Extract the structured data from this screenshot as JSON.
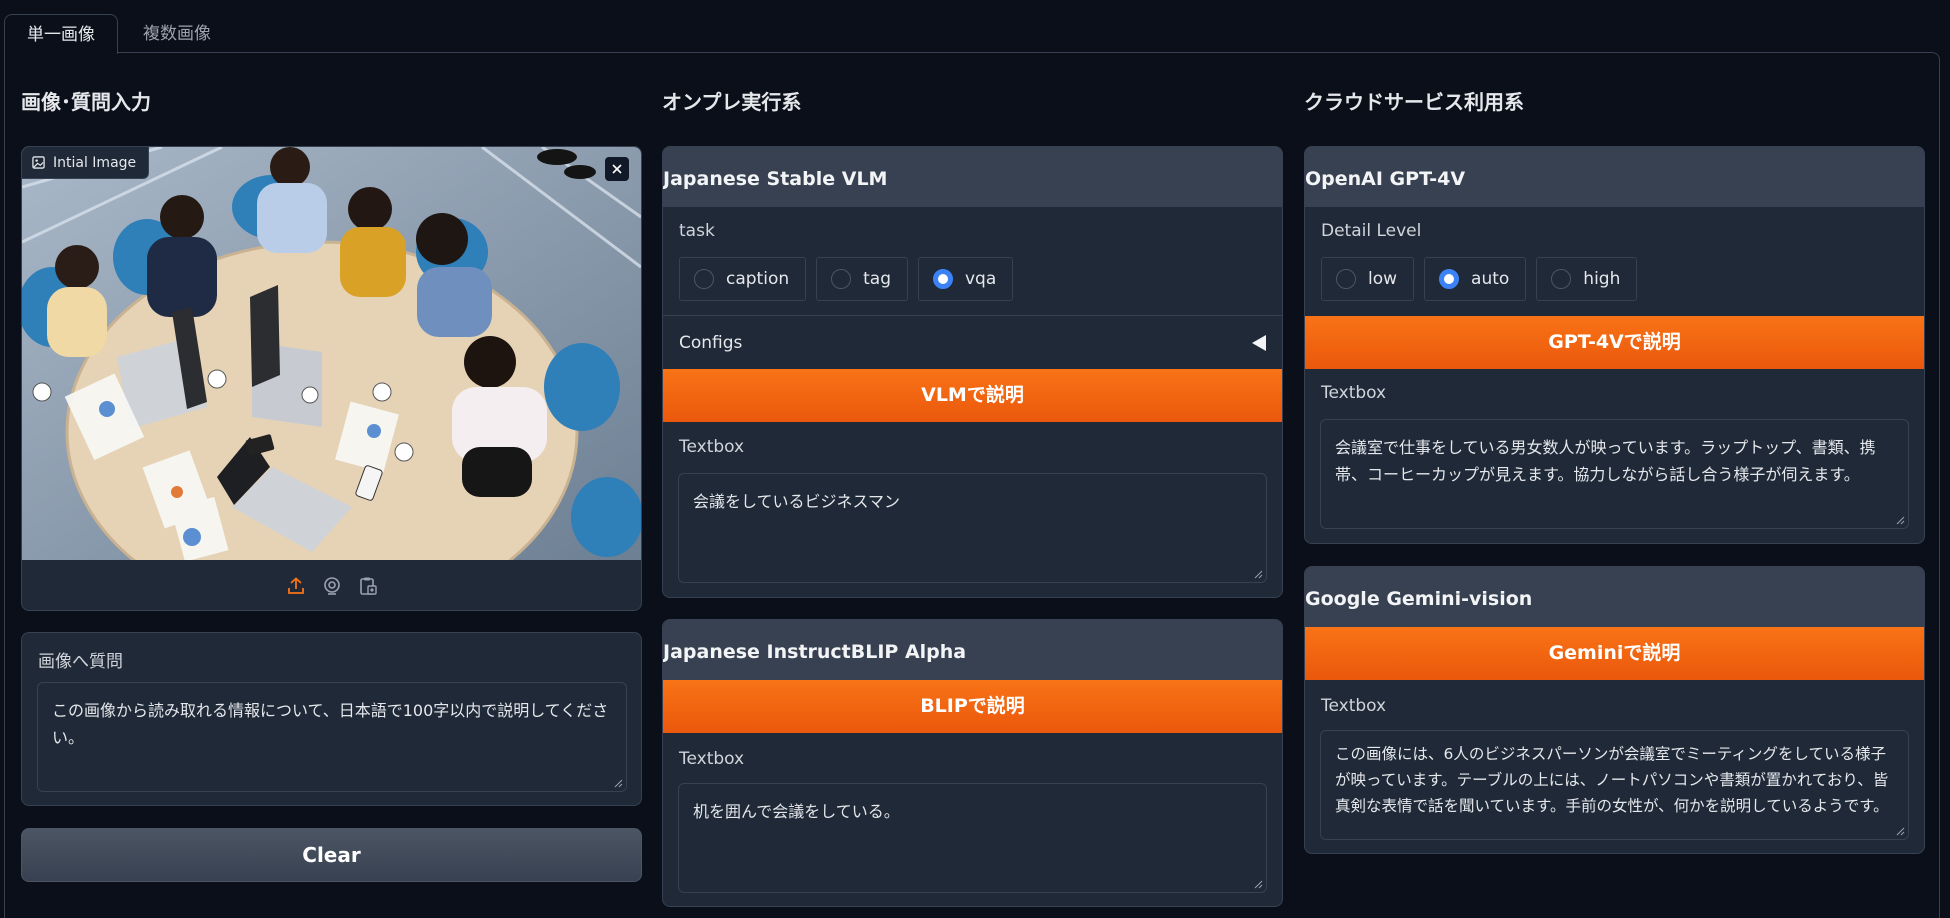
{
  "tabs": [
    {
      "label": "単一画像",
      "active": true
    },
    {
      "label": "複数画像",
      "active": false
    }
  ],
  "columns": {
    "input": {
      "heading": "画像･質問入力",
      "image": {
        "label": "Intial Image"
      },
      "question": {
        "label": "画像へ質問",
        "value": "この画像から読み取れる情報について、日本語で100字以内で説明してください。"
      },
      "clear_label": "Clear"
    },
    "onprem": {
      "heading": "オンプレ実行系",
      "stable_vlm": {
        "title": "Japanese Stable VLM",
        "task_label": "task",
        "task_options": [
          {
            "label": "caption",
            "checked": false
          },
          {
            "label": "tag",
            "checked": false
          },
          {
            "label": "vqa",
            "checked": true
          }
        ],
        "configs_label": "Configs",
        "button_label": "VLMで説明",
        "textbox_label": "Textbox",
        "textbox_value": "会議をしているビジネスマン"
      },
      "instructblip": {
        "title": "Japanese InstructBLIP Alpha",
        "button_label": "BLIPで説明",
        "textbox_label": "Textbox",
        "textbox_value": "机を囲んで会議をしている。"
      }
    },
    "cloud": {
      "heading": "クラウドサービス利用系",
      "gpt4v": {
        "title": "OpenAI GPT-4V",
        "detail_label": "Detail Level",
        "detail_options": [
          {
            "label": "low",
            "checked": false
          },
          {
            "label": "auto",
            "checked": true
          },
          {
            "label": "high",
            "checked": false
          }
        ],
        "button_label": "GPT-4Vで説明",
        "textbox_label": "Textbox",
        "textbox_value": "会議室で仕事をしている男女数人が映っています。ラップトップ、書類、携帯、コーヒーカップが見えます。協力しながら話し合う様子が伺えます。"
      },
      "gemini": {
        "title": "Google Gemini-vision",
        "button_label": "Geminiで説明",
        "textbox_label": "Textbox",
        "textbox_value": "この画像には、6人のビジネスパーソンが会議室でミーティングをしている様子が映っています。テーブルの上には、ノートパソコンや書類が置かれており、皆真剣な表情で話を聞いています。手前の女性が、何かを説明しているようです。"
      }
    }
  },
  "colors": {
    "background": "#0b0f19",
    "panel": "#1f2937",
    "panel_header": "#374151",
    "accent_orange": "#f97316",
    "radio_checked": "#3b82f6"
  },
  "icons": [
    "image-icon",
    "close-icon",
    "upload-icon",
    "webcam-icon",
    "clipboard-icon",
    "resize-grip-icon",
    "collapse-triangle-icon"
  ]
}
